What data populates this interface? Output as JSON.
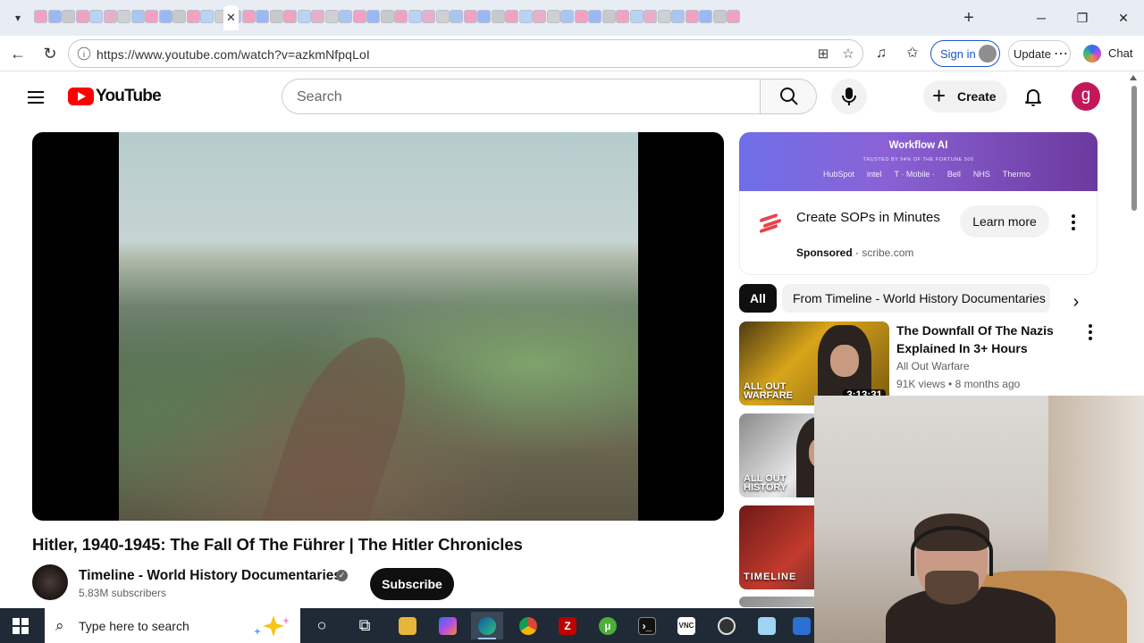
{
  "browser": {
    "url": "https://www.youtube.com/watch?v=azkmNfpqLoI",
    "sign_in_label": "Sign in",
    "update_label": "Update",
    "chat_label": "Chat",
    "tab_count_icons": 52
  },
  "youtube": {
    "logo_text": "YouTube",
    "search_placeholder": "Search",
    "create_label": "Create",
    "avatar_letter": "g"
  },
  "video": {
    "title": "Hitler, 1940-1945: The Fall Of The Führer | The Hitler Chronicles",
    "channel_name": "Timeline - World History Documentaries",
    "subscribers": "5.83M subscribers",
    "subscribe_label": "Subscribe"
  },
  "ad": {
    "banner_title": "Workflow AI",
    "banner_subtitle": "TRUSTED BY 94% OF THE FORTUNE 500",
    "banner_brands": [
      "HubSpot",
      "intel",
      "T · Mobile ·",
      "Bell",
      "NHS",
      "Thermo"
    ],
    "headline": "Create SOPs in Minutes",
    "sponsored_label": "Sponsored",
    "domain": "scribe.com",
    "cta_label": "Learn more"
  },
  "chips": {
    "all": "All",
    "from": "From Timeline - World History Documentaries"
  },
  "recommendations": [
    {
      "title": "The Downfall Of The Nazis Explained In 3+ Hours",
      "channel": "All Out Warfare",
      "views": "91K views",
      "age": "8 months ago",
      "duration": "3:13:31",
      "thumb_text_line1": "ALL OUT",
      "thumb_text_line2": "WARFARE"
    },
    {
      "thumb_text_line1": "ALL OUT",
      "thumb_text_line2": "HISTORY"
    },
    {
      "thumb_text_line1": "TIMELINE"
    }
  ],
  "taskbar": {
    "search_placeholder": "Type here to search"
  },
  "colors": {
    "youtube_red": "#ff0000",
    "brand_blue": "#1a56c9",
    "taskbar": "#1f2a36",
    "ad_gradient_start": "#6f6fe8",
    "ad_gradient_end": "#6c3a9e"
  }
}
